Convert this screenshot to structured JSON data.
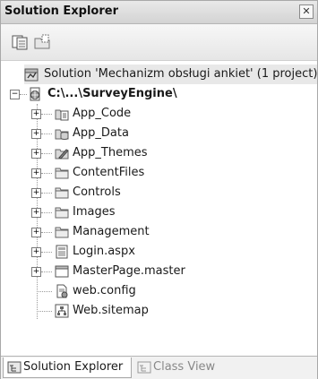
{
  "panel": {
    "title": "Solution Explorer",
    "close_glyph": "✕"
  },
  "toolbar": {
    "buttons": [
      {
        "name": "properties-button",
        "icon": "properties-icon"
      },
      {
        "name": "show-all-files-button",
        "icon": "show-all-files-icon"
      }
    ]
  },
  "tree": {
    "solution": {
      "label": "Solution 'Mechanizm obsługi ankiet' (1 project)",
      "icon": "solution-icon"
    },
    "project": {
      "prefix": "C:\\...\\",
      "bold_label": "SurveyEngine",
      "suffix": "\\",
      "icon": "website-project-icon"
    },
    "items": [
      {
        "label": "App_Code",
        "icon": "app-code-folder-icon",
        "expandable": true
      },
      {
        "label": "App_Data",
        "icon": "app-data-folder-icon",
        "expandable": true
      },
      {
        "label": "App_Themes",
        "icon": "app-themes-folder-icon",
        "expandable": true
      },
      {
        "label": "ContentFiles",
        "icon": "folder-icon",
        "expandable": true
      },
      {
        "label": "Controls",
        "icon": "folder-icon",
        "expandable": true
      },
      {
        "label": "Images",
        "icon": "folder-icon",
        "expandable": true
      },
      {
        "label": "Management",
        "icon": "folder-icon",
        "expandable": true
      },
      {
        "label": "Login.aspx",
        "icon": "aspx-file-icon",
        "expandable": true
      },
      {
        "label": "MasterPage.master",
        "icon": "master-page-icon",
        "expandable": true
      },
      {
        "label": "web.config",
        "icon": "config-file-icon",
        "expandable": false
      },
      {
        "label": "Web.sitemap",
        "icon": "sitemap-file-icon",
        "expandable": false
      }
    ]
  },
  "tabs": [
    {
      "label": "Solution Explorer",
      "active": true,
      "icon": "solution-explorer-icon"
    },
    {
      "label": "Class View",
      "active": false,
      "icon": "class-view-icon"
    }
  ]
}
